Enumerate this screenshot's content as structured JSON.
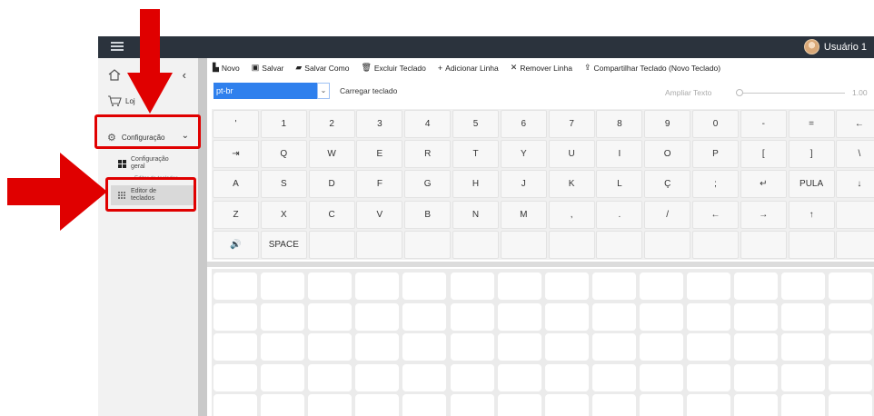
{
  "header": {
    "user_name": "Usuário 1"
  },
  "sidebar": {
    "home_label": "",
    "loja_label": "Loj",
    "config_label": "Configuração",
    "general_config_label_1": "Configuração",
    "general_config_label_2": "geral",
    "editor_overlay_label": "Editor de teclados",
    "editor_label_1": "Editor de",
    "editor_label_2": "teclados"
  },
  "toolbar": {
    "new_label": "Novo",
    "save_label": "Salvar",
    "save_as_label": "Salvar Como",
    "delete_label": "Excluir Teclado",
    "add_row_label": "Adicionar Linha",
    "remove_row_label": "Remover Linha",
    "share_label": "Compartilhar Teclado (Novo Teclado)"
  },
  "controls": {
    "language_value": "pt-br",
    "load_label": "Carregar teclado",
    "zoom_label": "Ampliar Texto",
    "zoom_value": "1.00"
  },
  "keyboard": {
    "rows": [
      [
        "'",
        "1",
        "2",
        "3",
        "4",
        "5",
        "6",
        "7",
        "8",
        "9",
        "0",
        "-",
        "=",
        "←"
      ],
      [
        "⇥",
        "Q",
        "W",
        "E",
        "R",
        "T",
        "Y",
        "U",
        "I",
        "O",
        "P",
        "[",
        "]",
        "\\"
      ],
      [
        "A",
        "S",
        "D",
        "F",
        "G",
        "H",
        "J",
        "K",
        "L",
        "Ç",
        ";",
        "↵",
        "PULA",
        "↓"
      ],
      [
        "Z",
        "X",
        "C",
        "V",
        "B",
        "N",
        "M",
        ",",
        ".",
        "/",
        "←",
        "→",
        "↑",
        ""
      ],
      [
        "🔊",
        "SPACE",
        "",
        "",
        "",
        "",
        "",
        "",
        "",
        "",
        "",
        "",
        "",
        ""
      ]
    ]
  },
  "annotations": {
    "color": "#e00000"
  }
}
